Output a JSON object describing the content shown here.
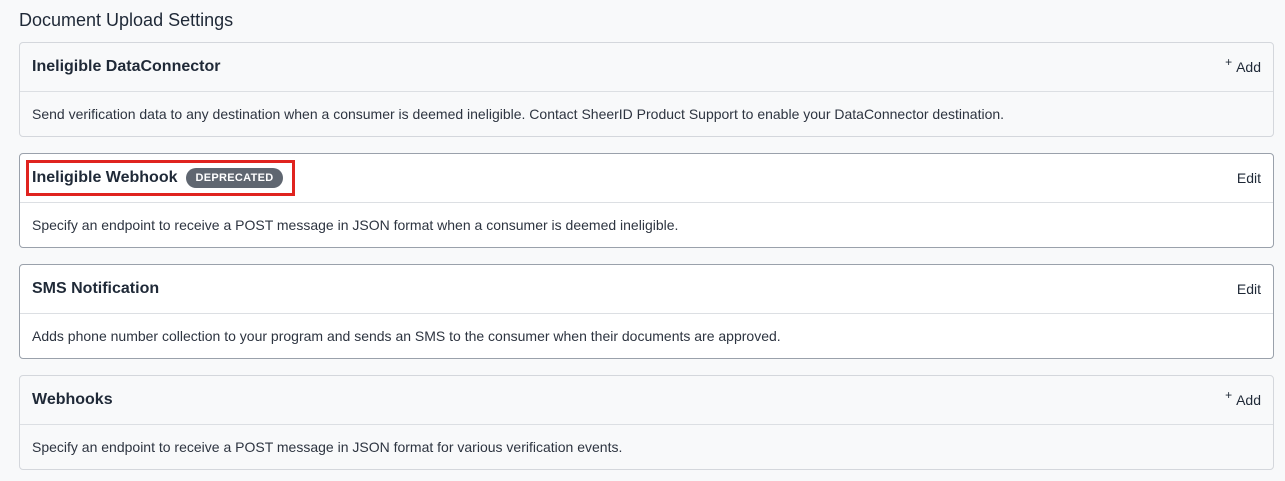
{
  "page": {
    "title": "Document Upload Settings"
  },
  "cards": [
    {
      "title": "Ineligible DataConnector",
      "action_icon": "+",
      "action_label": "Add",
      "description": "Send verification data to any destination when a consumer is deemed ineligible. Contact SheerID Product Support to enable your DataConnector destination."
    },
    {
      "title": "Ineligible Webhook",
      "badge": "DEPRECATED",
      "action_label": "Edit",
      "description": "Specify an endpoint to receive a POST message in JSON format when a consumer is deemed ineligible."
    },
    {
      "title": "SMS Notification",
      "action_label": "Edit",
      "description": "Adds phone number collection to your program and sends an SMS to the consumer when their documents are approved."
    },
    {
      "title": "Webhooks",
      "action_icon": "+",
      "action_label": "Add",
      "description": "Specify an endpoint to receive a POST message in JSON format for various verification events."
    }
  ],
  "colors": {
    "highlight": "#e0231f",
    "badge_bg": "#5f6670"
  }
}
